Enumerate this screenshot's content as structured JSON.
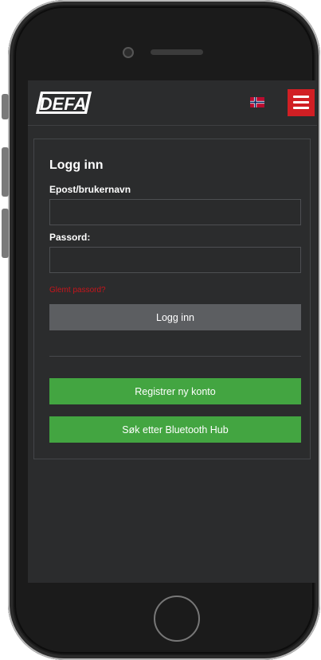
{
  "header": {
    "logo_text": "DEFA",
    "language_icon": "norway-flag-icon",
    "menu_icon": "hamburger-menu-icon"
  },
  "login": {
    "title": "Logg inn",
    "username_label": "Epost/brukernavn",
    "username_value": "",
    "password_label": "Passord:",
    "password_value": "",
    "forgot_password": "Glemt passord?",
    "login_button": "Logg inn",
    "register_button": "Registrer ny konto",
    "bluetooth_button": "Søk etter Bluetooth Hub"
  },
  "colors": {
    "accent_red": "#d11f24",
    "green": "#43a541",
    "background": "#2b2c2d"
  }
}
